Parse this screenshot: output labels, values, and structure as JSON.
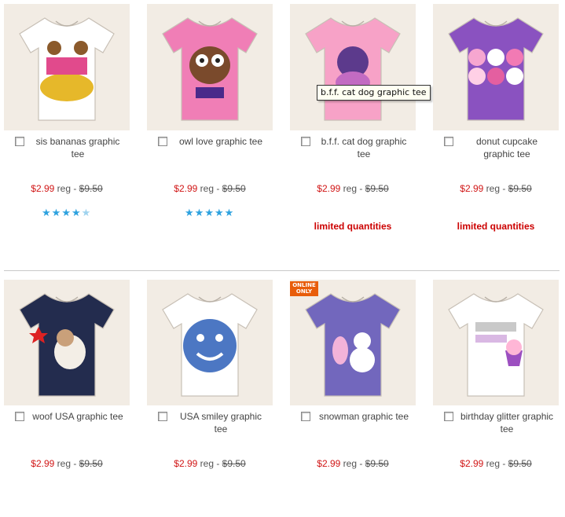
{
  "products": [
    {
      "name": "sis bananas graphic tee",
      "sale": "$2.99",
      "reg": "reg - ",
      "orig": "$9.50",
      "rating": 4.5,
      "tee_color": "#ffffff",
      "art": "bananas"
    },
    {
      "name": "owl love graphic tee",
      "sale": "$2.99",
      "reg": "reg - ",
      "orig": "$9.50",
      "rating": 5,
      "tee_color": "#f07eb6",
      "art": "owl"
    },
    {
      "name": "b.f.f. cat dog graphic tee",
      "sale": "$2.99",
      "reg": "reg - ",
      "orig": "$9.50",
      "limited": "limited quantities",
      "tee_color": "#f7a2c7",
      "art": "catdog"
    },
    {
      "name": "donut cupcake graphic tee",
      "sale": "$2.99",
      "reg": "reg - ",
      "orig": "$9.50",
      "limited": "limited quantities",
      "tee_color": "#8a52c0",
      "art": "donut"
    },
    {
      "name": "woof USA graphic tee",
      "sale": "$2.99",
      "reg": "reg - ",
      "orig": "$9.50",
      "tee_color": "#232c4e",
      "art": "woof"
    },
    {
      "name": "USA smiley graphic tee",
      "sale": "$2.99",
      "reg": "reg - ",
      "orig": "$9.50",
      "tee_color": "#ffffff",
      "art": "smiley"
    },
    {
      "name": "snowman graphic tee",
      "sale": "$2.99",
      "reg": "reg - ",
      "orig": "$9.50",
      "badge": [
        "ONLINE",
        "ONLY"
      ],
      "tee_color": "#7267bd",
      "art": "snowman"
    },
    {
      "name": "birthday glitter graphic tee",
      "sale": "$2.99",
      "reg": "reg - ",
      "orig": "$9.50",
      "tee_color": "#ffffff",
      "art": "birthday"
    }
  ],
  "tooltip": "b.f.f. cat dog graphic tee",
  "colors": {
    "sale": "#d11717",
    "limited": "#cc0000",
    "star": "#2ea2df",
    "badge": "#e85d0b",
    "image_bg": "#f2ece4"
  },
  "icons": {
    "star": "star-icon",
    "checkbox": "compare-checkbox"
  }
}
